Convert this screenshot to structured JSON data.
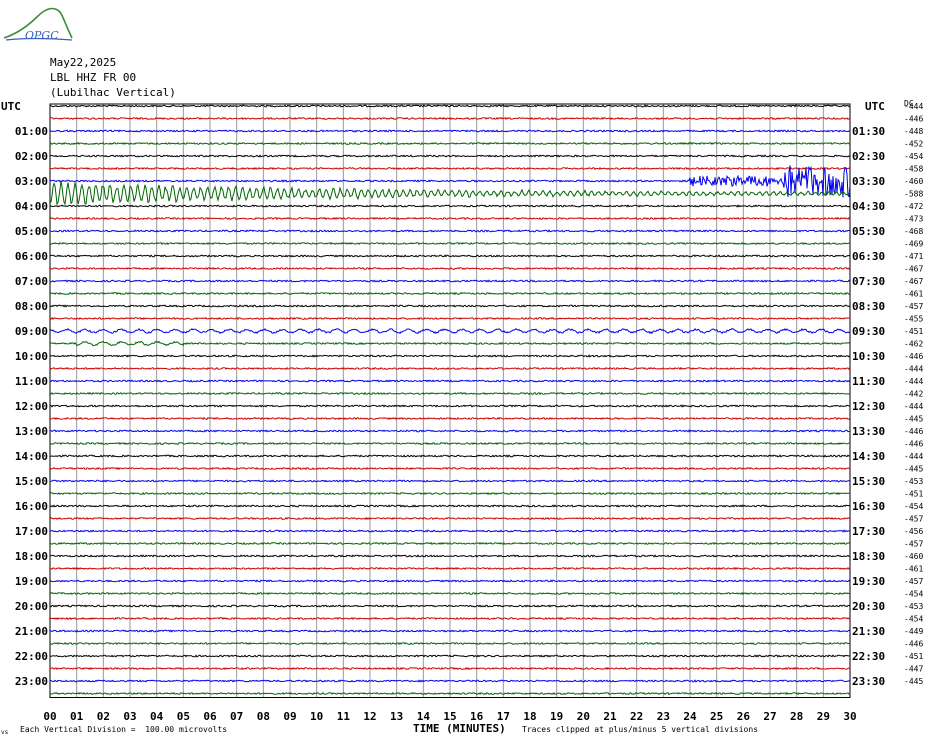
{
  "header": {
    "logo_text": "OPGC",
    "date": "May22,2025",
    "station": "LBL HHZ FR 00",
    "location": "(Lubilhac Vertical)"
  },
  "labels": {
    "utc_left": "UTC",
    "utc_right": "UTC",
    "dc": "DC",
    "each_division": "Each Vertical Division =  100.00 microvolts",
    "time_axis": "TIME (MINUTES)",
    "clipped": "Traces clipped at plus/minus 5 vertical divisions",
    "corner_mark": "vs"
  },
  "colors": {
    "trace_cycle": [
      "#000000",
      "#cc0000",
      "#0000ee",
      "#006600"
    ],
    "grid": "#999999",
    "frame": "#000000"
  },
  "chart_data": {
    "type": "line",
    "title": "",
    "xlabel": "TIME (MINUTES)",
    "ylabel": "UTC",
    "xlim": [
      0,
      30
    ],
    "x_ticks": [
      "00",
      "01",
      "02",
      "03",
      "04",
      "05",
      "06",
      "07",
      "08",
      "09",
      "10",
      "11",
      "12",
      "13",
      "14",
      "15",
      "16",
      "17",
      "18",
      "19",
      "20",
      "21",
      "22",
      "23",
      "24",
      "25",
      "26",
      "27",
      "28",
      "29",
      "30"
    ],
    "grid": true,
    "trace_count": 48,
    "left_hour_labels": [
      "01:00",
      "02:00",
      "03:00",
      "04:00",
      "05:00",
      "06:00",
      "07:00",
      "08:00",
      "09:00",
      "10:00",
      "11:00",
      "12:00",
      "13:00",
      "14:00",
      "15:00",
      "16:00",
      "17:00",
      "18:00",
      "19:00",
      "20:00",
      "21:00",
      "22:00",
      "23:00"
    ],
    "right_hour_labels": [
      "01:30",
      "02:30",
      "03:30",
      "04:30",
      "05:30",
      "06:30",
      "07:30",
      "08:30",
      "09:30",
      "10:30",
      "11:30",
      "12:30",
      "13:30",
      "14:30",
      "15:30",
      "16:30",
      "17:30",
      "18:30",
      "19:30",
      "20:30",
      "21:30",
      "22:30",
      "23:30"
    ],
    "dc_offsets": [
      "-444",
      "-446",
      "-448",
      "-452",
      "-454",
      "-458",
      "-460",
      "-588",
      "-472",
      "-473",
      "-468",
      "-469",
      "-471",
      "-467",
      "-467",
      "-461",
      "-457",
      "-455",
      "-451",
      "-462",
      "-446",
      "-444",
      "-444",
      "-442",
      "-444",
      "-445",
      "-446",
      "-446",
      "-444",
      "-445",
      "-453",
      "-451",
      "-454",
      "-457",
      "-456",
      "-457",
      "-460",
      "-461",
      "-457",
      "-454",
      "-453",
      "-454",
      "-449",
      "-446",
      "-451",
      "-447",
      "-445"
    ],
    "events": [
      {
        "trace_index": 7,
        "x_start_min": 0,
        "x_end_min": 30,
        "amplitude": "high",
        "decay": true
      },
      {
        "trace_index": 6,
        "x_start_min": 24,
        "x_end_min": 30,
        "amplitude": "clipped"
      },
      {
        "trace_index": 18,
        "x_start_min": 0,
        "x_end_min": 30,
        "amplitude": "low-wave"
      },
      {
        "trace_index": 19,
        "x_start_min": 1,
        "x_end_min": 5,
        "amplitude": "low-wave"
      }
    ]
  }
}
